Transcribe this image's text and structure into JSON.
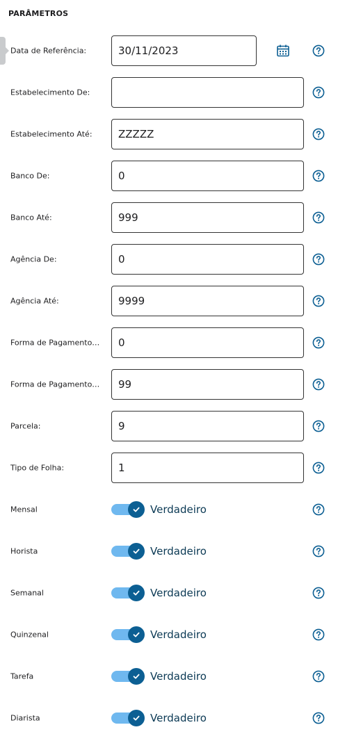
{
  "section": {
    "title": "PARÂMETROS"
  },
  "fields": [
    {
      "label": "Data de Referência:",
      "value": "30/11/2023",
      "date": true
    },
    {
      "label": "Estabelecimento De:",
      "value": ""
    },
    {
      "label": "Estabelecimento Até:",
      "value": "ZZZZZ"
    },
    {
      "label": "Banco De:",
      "value": "0"
    },
    {
      "label": "Banco Até:",
      "value": "999"
    },
    {
      "label": "Agência De:",
      "value": "0"
    },
    {
      "label": "Agência Até:",
      "value": "9999"
    },
    {
      "label": "Forma de Pagamento ...",
      "value": "0"
    },
    {
      "label": "Forma de Pagamento ...",
      "value": "99"
    },
    {
      "label": "Parcela:",
      "value": "9"
    },
    {
      "label": "Tipo de Folha:",
      "value": "1"
    }
  ],
  "toggles": [
    {
      "label": "Mensal",
      "state": "Verdadeiro",
      "on": true
    },
    {
      "label": "Horista",
      "state": "Verdadeiro",
      "on": true
    },
    {
      "label": "Semanal",
      "state": "Verdadeiro",
      "on": true
    },
    {
      "label": "Quinzenal",
      "state": "Verdadeiro",
      "on": true
    },
    {
      "label": "Tarefa",
      "state": "Verdadeiro",
      "on": true
    },
    {
      "label": "Diarista",
      "state": "Verdadeiro",
      "on": true
    }
  ],
  "icons": {
    "date": "calendar-icon",
    "help": "help-icon",
    "toggle_check": "check-icon"
  },
  "colors": {
    "accent": "#0c5f93",
    "track": "#6fb8ef",
    "text": "#1d1d1f"
  }
}
